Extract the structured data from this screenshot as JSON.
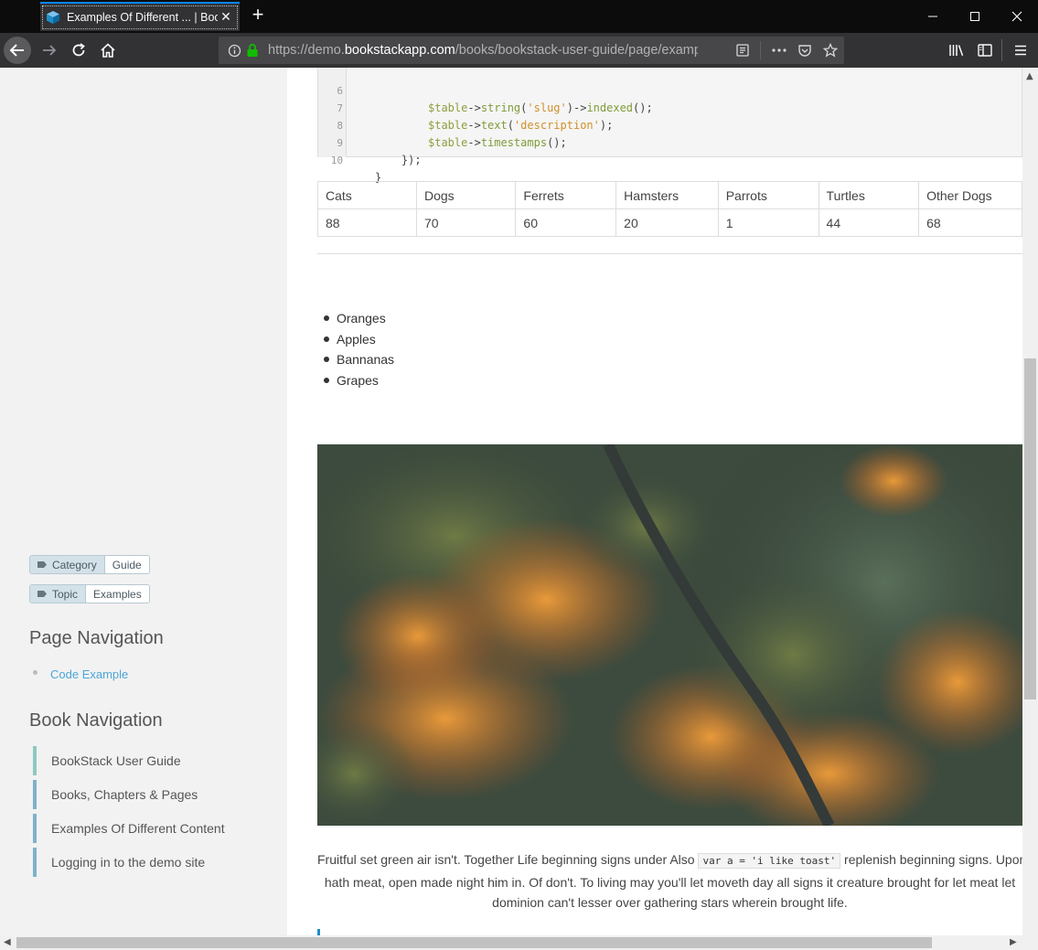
{
  "browser": {
    "tab_title": "Examples Of Different ... | BookStack",
    "new_tab_label": "+",
    "url_prefix": "https://demo.",
    "url_host": "bookstackapp.com",
    "url_path": "/books/bookstack-user-guide/page/examples-of-different-content"
  },
  "sidebar": {
    "tags": [
      {
        "name": "Category",
        "value": "Guide"
      },
      {
        "name": "Topic",
        "value": "Examples"
      }
    ],
    "page_nav_title": "Page Navigation",
    "page_nav_items": [
      "Code Example"
    ],
    "book_nav_title": "Book Navigation",
    "book_nav_items": [
      "BookStack User Guide",
      "Books, Chapters & Pages",
      "Examples Of Different Content",
      "Logging in to the demo site"
    ]
  },
  "code": {
    "lines": [
      {
        "n": "6",
        "indent": "        ",
        "var": "$table",
        "arrow": "->",
        "fn": "string",
        "open": "(",
        "str": "'slug'",
        "close": ")",
        "tail_arrow": "->",
        "tail_fn": "indexed",
        "tail": "();"
      },
      {
        "n": "7",
        "indent": "        ",
        "var": "$table",
        "arrow": "->",
        "fn": "text",
        "open": "(",
        "str": "'description'",
        "close": ");",
        "tail_arrow": "",
        "tail_fn": "",
        "tail": ""
      },
      {
        "n": "8",
        "indent": "        ",
        "var": "$table",
        "arrow": "->",
        "fn": "timestamps",
        "open": "();",
        "str": "",
        "close": "",
        "tail_arrow": "",
        "tail_fn": "",
        "tail": ""
      },
      {
        "n": "9",
        "plain": "    });"
      },
      {
        "n": "10",
        "plain": "}"
      }
    ]
  },
  "table": {
    "headers": [
      "Cats",
      "Dogs",
      "Ferrets",
      "Hamsters",
      "Parrots",
      "Turtles",
      "Other Dogs"
    ],
    "values": [
      "88",
      "70",
      "60",
      "20",
      "1",
      "44",
      "68"
    ]
  },
  "list": [
    "Oranges",
    "Apples",
    "Bannanas",
    "Grapes"
  ],
  "caption": {
    "before": "Fruitful set green air isn't. Together Life beginning signs under Also ",
    "code": "var a = 'i like toast'",
    "after": " replenish beginning signs. Upon",
    "line2": "hath meat, open made night him in. Of don't. To living may you'll let moveth day all signs it creature brought for let meat let",
    "line3": "dominion can't lesser over gathering stars wherein brought life."
  },
  "colors": {
    "accent": "#0a84ff",
    "link": "#4ea5d9",
    "book_nav_bar": "#7fb2c9"
  }
}
